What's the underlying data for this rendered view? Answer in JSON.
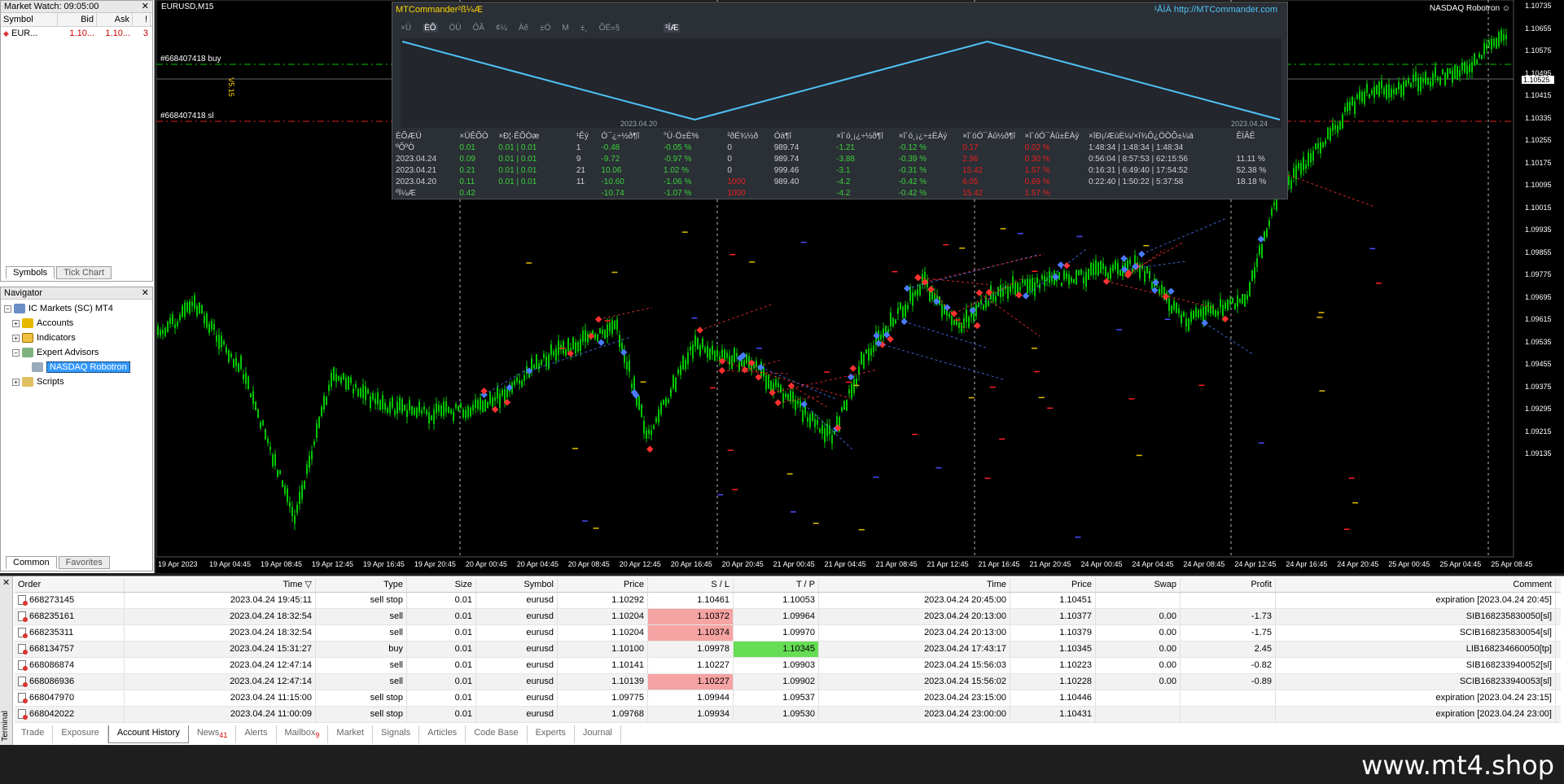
{
  "market_watch": {
    "title": "Market Watch: 09:05:00",
    "columns": [
      "Symbol",
      "Bid",
      "Ask",
      "!"
    ],
    "rows": [
      {
        "symbol": "EUR...",
        "bid": "1.10...",
        "ask": "1.10...",
        "spread": "3"
      }
    ],
    "tabs": [
      "Symbols",
      "Tick Chart"
    ]
  },
  "navigator": {
    "title": "Navigator",
    "items": [
      "IC Markets (SC) MT4",
      "Accounts",
      "Indicators",
      "Expert Advisors",
      "NASDAQ Robotron",
      "Scripts"
    ],
    "tabs": [
      "Common",
      "Favorites"
    ]
  },
  "chart": {
    "symbol_label": "EURUSD,M15",
    "ea_label": "NASDAQ Robotron ☺",
    "order_labels": [
      "#668407418 buy",
      "#668407418 sl"
    ],
    "version_label": "V5.15",
    "price_axis": [
      "1.10735",
      "1.10655",
      "1.10575",
      "1.10525",
      "1.10495",
      "1.10415",
      "1.10335",
      "1.10255",
      "1.10175",
      "1.10095",
      "1.10015",
      "1.09935",
      "1.09855",
      "1.09775",
      "1.09695",
      "1.09615",
      "1.09535",
      "1.09455",
      "1.09375",
      "1.09295",
      "1.09215",
      "1.09135"
    ],
    "time_axis": [
      "19 Apr 2023",
      "19 Apr 04:45",
      "19 Apr 08:45",
      "19 Apr 12:45",
      "19 Apr 16:45",
      "19 Apr 20:45",
      "20 Apr 00:45",
      "20 Apr 04:45",
      "20 Apr 08:45",
      "20 Apr 12:45",
      "20 Apr 16:45",
      "20 Apr 20:45",
      "21 Apr 00:45",
      "21 Apr 04:45",
      "21 Apr 08:45",
      "21 Apr 12:45",
      "21 Apr 16:45",
      "21 Apr 20:45",
      "24 Apr 00:45",
      "24 Apr 04:45",
      "24 Apr 08:45",
      "24 Apr 12:45",
      "24 Apr 16:45",
      "24 Apr 20:45",
      "25 Apr 00:45",
      "25 Apr 04:45",
      "25 Apr 08:45"
    ],
    "current_price": "1.10525",
    "colors": {
      "candle": "#00c800",
      "buy_line": "#00c800",
      "sl_line": "#e02020",
      "accent": "#4fc3f7"
    }
  },
  "mtcommander": {
    "title": "MTCommander²ß¼Æ",
    "url": "¹ÅÌÄ http://MTCommander.com",
    "tabs": [
      "×Ü",
      "ÈÕ",
      "ÖÜ",
      "ÔÂ",
      "¢¼",
      "Äê",
      "±Ó",
      "M",
      "±¸",
      "ÕË»§"
    ],
    "extra_tab": "¹ÍÆ",
    "graph_dates": [
      "2023.04.20",
      "2023.04.24"
    ],
    "graph_values": [
      0.0,
      -10.74,
      0.0,
      -10.74
    ],
    "columns": [
      "ÈÕÆÚ",
      "×ÜÊÕÒ",
      "×Ð¦·ÊÕÒæ",
      "¹Êý",
      "Ó¯¿÷½ð¶î",
      "°Ù·Ö±È%",
      "²ðÉ¾½ð",
      "Óà¶î",
      "×î´ó¸¡¿÷½ð¶î",
      "×î´ó¸¡¿÷±ÈÀý",
      "×î´óÓ¯Àû½ð¶î",
      "×î´óÓ¯Àû±ÈÀý",
      "×îÐ¡/ÆùÈ¼/×î¾Ô¿ÖÒÕ±¼ä",
      "ÊÌÂÊ"
    ],
    "rows": [
      [
        "ºÕºÒ",
        "0.01",
        "0.01 | 0.01",
        "1",
        "-0.48",
        "-0.05 %",
        "0",
        "989.74",
        "-1.21",
        "-0.12 %",
        "0.17",
        "0.02 %",
        "1:48:34 | 1:48:34 | 1:48:34",
        ""
      ],
      [
        "2023.04.24",
        "0.09",
        "0.01 | 0.01",
        "9",
        "-9.72",
        "-0.97 %",
        "0",
        "989.74",
        "-3.88",
        "-0.39 %",
        "2.96",
        "0.30 %",
        "0:56:04 | 8:57:53 | 62:15:56",
        "11.11 %"
      ],
      [
        "2023.04.21",
        "0.21",
        "0.01 | 0.01",
        "21",
        "10.06",
        "1.02 %",
        "0",
        "999.46",
        "-3.1",
        "-0.31 %",
        "15.42",
        "1.57 %",
        "0:16:31 | 6:49:40 | 17:54:52",
        "52.38 %"
      ],
      [
        "2023.04.20",
        "0.11",
        "0.01 | 0.01",
        "11",
        "-10.60",
        "-1.06 %",
        "1000",
        "989.40",
        "-4.2",
        "-0.42 %",
        "6.05",
        "0.69 %",
        "0:22:40 | 1:50:22 | 5:37:58",
        "18.18 %"
      ],
      [
        "ºÏ¼Æ",
        "0.42",
        "",
        "",
        "-10.74",
        "-1.07 %",
        "1000",
        "",
        "-4.2",
        "-0.42 %",
        "15.42",
        "1.57 %",
        "",
        ""
      ]
    ]
  },
  "terminal": {
    "side_label": "Terminal",
    "columns": [
      "Order",
      "Time",
      "Type",
      "Size",
      "Symbol",
      "Price",
      "S / L",
      "T / P",
      "Time",
      "Price",
      "Swap",
      "Profit",
      "Comment"
    ],
    "rows": [
      [
        "668273145",
        "2023.04.24 19:45:11",
        "sell stop",
        "0.01",
        "eurusd",
        "1.10292",
        "1.10461",
        "1.10053",
        "2023.04.24 20:45:00",
        "1.10451",
        "",
        "",
        "expiration [2023.04.24 20:45]"
      ],
      [
        "668235161",
        "2023.04.24 18:32:54",
        "sell",
        "0.01",
        "eurusd",
        "1.10204",
        "1.10372",
        "1.09964",
        "2023.04.24 20:13:00",
        "1.10377",
        "0.00",
        "-1.73",
        "SIB168235830050[sl]"
      ],
      [
        "668235311",
        "2023.04.24 18:32:54",
        "sell",
        "0.01",
        "eurusd",
        "1.10204",
        "1.10374",
        "1.09970",
        "2023.04.24 20:13:00",
        "1.10379",
        "0.00",
        "-1.75",
        "SCIB168235830054[sl]"
      ],
      [
        "668134757",
        "2023.04.24 15:31:27",
        "buy",
        "0.01",
        "eurusd",
        "1.10100",
        "1.09978",
        "1.10345",
        "2023.04.24 17:43:17",
        "1.10345",
        "0.00",
        "2.45",
        "LIB168234660050[tp]"
      ],
      [
        "668086874",
        "2023.04.24 12:47:14",
        "sell",
        "0.01",
        "eurusd",
        "1.10141",
        "1.10227",
        "1.09903",
        "2023.04.24 15:56:03",
        "1.10223",
        "0.00",
        "-0.82",
        "SIB168233940052[sl]"
      ],
      [
        "668086936",
        "2023.04.24 12:47:14",
        "sell",
        "0.01",
        "eurusd",
        "1.10139",
        "1.10227",
        "1.09902",
        "2023.04.24 15:56:02",
        "1.10228",
        "0.00",
        "-0.89",
        "SCIB168233940053[sl]"
      ],
      [
        "668047970",
        "2023.04.24 11:15:00",
        "sell stop",
        "0.01",
        "eurusd",
        "1.09775",
        "1.09944",
        "1.09537",
        "2023.04.24 23:15:00",
        "1.10446",
        "",
        "",
        "expiration [2023.04.24 23:15]"
      ],
      [
        "668042022",
        "2023.04.24 11:00:09",
        "sell stop",
        "0.01",
        "eurusd",
        "1.09768",
        "1.09934",
        "1.09530",
        "2023.04.24 23:00:00",
        "1.10431",
        "",
        "",
        "expiration [2023.04.24 23:00]"
      ]
    ],
    "tabs": [
      {
        "label": "Trade",
        "badge": ""
      },
      {
        "label": "Exposure",
        "badge": ""
      },
      {
        "label": "Account History",
        "badge": ""
      },
      {
        "label": "News",
        "badge": "41"
      },
      {
        "label": "Alerts",
        "badge": ""
      },
      {
        "label": "Mailbox",
        "badge": "9"
      },
      {
        "label": "Market",
        "badge": ""
      },
      {
        "label": "Signals",
        "badge": ""
      },
      {
        "label": "Articles",
        "badge": ""
      },
      {
        "label": "Code Base",
        "badge": ""
      },
      {
        "label": "Experts",
        "badge": ""
      },
      {
        "label": "Journal",
        "badge": ""
      }
    ],
    "active_tab": "Account History"
  },
  "footer": {
    "brand": "www.mt4.shop"
  }
}
